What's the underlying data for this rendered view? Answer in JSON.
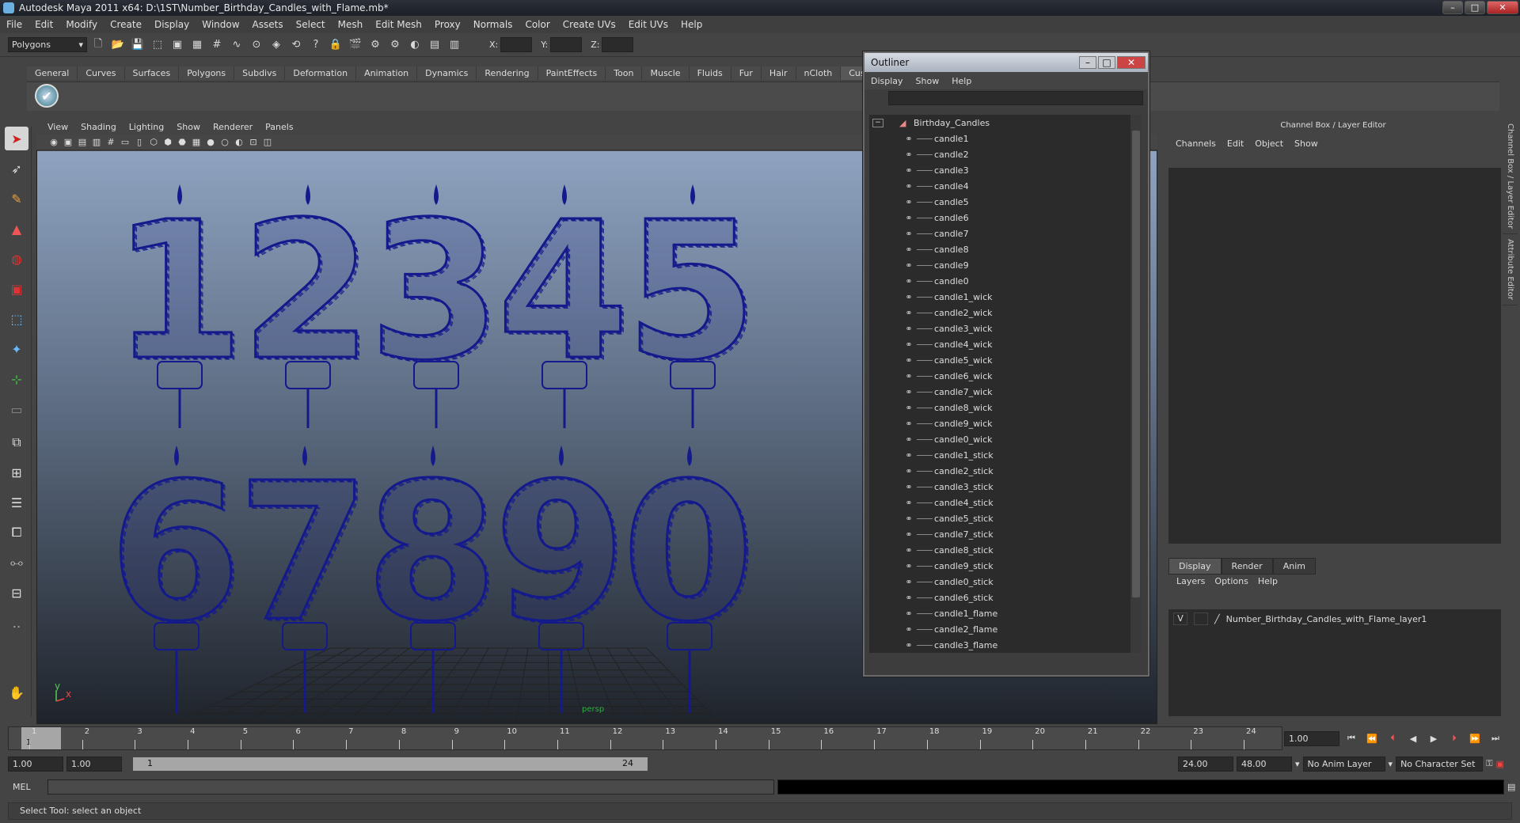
{
  "window": {
    "title": "Autodesk Maya 2011 x64: D:\\1ST\\Number_Birthday_Candles_with_Flame.mb*",
    "controls": [
      "–",
      "□",
      "✕"
    ]
  },
  "menubar": [
    "File",
    "Edit",
    "Modify",
    "Create",
    "Display",
    "Window",
    "Assets",
    "Select",
    "Mesh",
    "Edit Mesh",
    "Proxy",
    "Normals",
    "Color",
    "Create UVs",
    "Edit UVs",
    "Help"
  ],
  "statusline": {
    "mode": "Polygons",
    "x_label": "X:",
    "y_label": "Y:",
    "z_label": "Z:"
  },
  "shelf_tabs": [
    "General",
    "Curves",
    "Surfaces",
    "Polygons",
    "Subdivs",
    "Deformation",
    "Animation",
    "Dynamics",
    "Rendering",
    "PaintEffects",
    "Toon",
    "Muscle",
    "Fluids",
    "Fur",
    "Hair",
    "nCloth",
    "Cust"
  ],
  "shelf_active": "Cust",
  "panel_menu": [
    "View",
    "Shading",
    "Lighting",
    "Show",
    "Renderer",
    "Panels"
  ],
  "viewport": {
    "axis_y": "y",
    "axis_x": "x",
    "camera": "persp",
    "digits": [
      "1",
      "2",
      "3",
      "4",
      "5",
      "6",
      "7",
      "8",
      "9",
      "0"
    ],
    "wire_color": "#141a8c"
  },
  "outliner": {
    "title": "Outliner",
    "menu": [
      "Display",
      "Show",
      "Help"
    ],
    "root": "Birthday_Candles",
    "items": [
      "candle1",
      "candle2",
      "candle3",
      "candle4",
      "candle5",
      "candle6",
      "candle7",
      "candle8",
      "candle9",
      "candle0",
      "candle1_wick",
      "candle2_wick",
      "candle3_wick",
      "candle4_wick",
      "candle5_wick",
      "candle6_wick",
      "candle7_wick",
      "candle8_wick",
      "candle9_wick",
      "candle0_wick",
      "candle1_stick",
      "candle2_stick",
      "candle3_stick",
      "candle4_stick",
      "candle5_stick",
      "candle7_stick",
      "candle8_stick",
      "candle9_stick",
      "candle0_stick",
      "candle6_stick",
      "candle1_flame",
      "candle2_flame",
      "candle3_flame"
    ]
  },
  "channelbox": {
    "title": "Channel Box / Layer Editor",
    "menu": [
      "Channels",
      "Edit",
      "Object",
      "Show"
    ],
    "layer_tabs": [
      "Display",
      "Render",
      "Anim"
    ],
    "layer_menu": [
      "Layers",
      "Options",
      "Help"
    ],
    "layer_visibility": "V",
    "layer_name": "Number_Birthday_Candles_with_Flame_layer1"
  },
  "sidebar_tabs": [
    "Channel Box / Layer Editor",
    "Attribute Editor"
  ],
  "timeslider": {
    "ticks": [
      "1",
      "2",
      "3",
      "4",
      "5",
      "6",
      "7",
      "8",
      "9",
      "10",
      "11",
      "12",
      "13",
      "14",
      "15",
      "16",
      "17",
      "18",
      "19",
      "20",
      "21",
      "22",
      "23",
      "24"
    ],
    "current_frame": "1",
    "current_time_field": "1.00"
  },
  "range": {
    "start": "1.00",
    "playback_start": "1.00",
    "range_start_label": "1",
    "range_end_label": "24",
    "playback_end": "24.00",
    "end": "48.00",
    "anim_layer": "No Anim Layer",
    "character_set": "No Character Set"
  },
  "cmd": {
    "label": "MEL"
  },
  "helpline": {
    "text": "Select Tool: select an object"
  }
}
